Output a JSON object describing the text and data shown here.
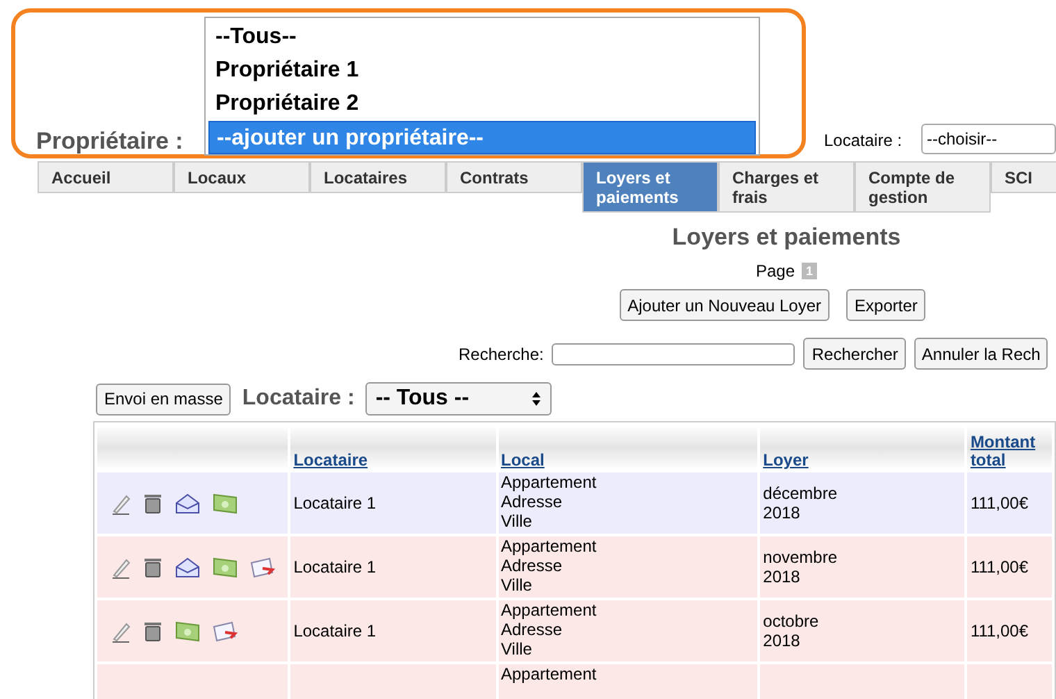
{
  "owner_picker": {
    "label": "Propriétaire :",
    "options": [
      {
        "label": "--Tous--",
        "selected": false
      },
      {
        "label": "Propriétaire 1",
        "selected": false
      },
      {
        "label": "Propriétaire 2",
        "selected": false
      },
      {
        "label": "--ajouter un propriétaire--",
        "selected": true
      }
    ]
  },
  "tenant_picker": {
    "label": "Locataire :",
    "value": "--choisir--"
  },
  "tabs": [
    {
      "label": "Accueil",
      "selected": false
    },
    {
      "label": "Locaux",
      "selected": false
    },
    {
      "label": "Locataires",
      "selected": false
    },
    {
      "label": "Contrats",
      "selected": false
    },
    {
      "label": "Loyers et paiements",
      "selected": true
    },
    {
      "label": "Charges et frais",
      "selected": false
    },
    {
      "label": "Compte de gestion",
      "selected": false
    },
    {
      "label": "SCI",
      "selected": false
    }
  ],
  "title": "Loyers et paiements",
  "pager": {
    "label": "Page",
    "pages": [
      "1"
    ]
  },
  "actions": [
    "Ajouter un Nouveau Loyer",
    "Exporter"
  ],
  "search": {
    "label": "Recherche:",
    "buttons": [
      "Rechercher",
      "Annuler la Rech"
    ]
  },
  "bulk_button": "Envoi en masse",
  "tenant_filter": {
    "label": "Locataire :",
    "value": "-- Tous --"
  },
  "table": {
    "columns": [
      "Locataire",
      "Local",
      "Loyer",
      "Montant total"
    ],
    "rows": [
      {
        "color": "#ececfc",
        "icons": [
          {
            "kind": "edit"
          },
          {
            "kind": "delete"
          },
          {
            "kind": "mail"
          },
          {
            "kind": "money"
          }
        ],
        "tenant": "Locataire 1",
        "local": [
          "Appartement",
          "Adresse",
          "Ville"
        ],
        "rent": [
          "décembre",
          "2018"
        ],
        "amount": "111,00€"
      },
      {
        "color": "#fde8e8",
        "icons": [
          {
            "kind": "edit"
          },
          {
            "kind": "delete"
          },
          {
            "kind": "mail"
          },
          {
            "kind": "money"
          },
          {
            "kind": "send"
          }
        ],
        "tenant": "Locataire 1",
        "local": [
          "Appartement",
          "Adresse",
          "Ville"
        ],
        "rent": [
          "novembre",
          "2018"
        ],
        "amount": "111,00€"
      },
      {
        "color": "#fde8e8",
        "icons": [
          {
            "kind": "edit"
          },
          {
            "kind": "delete"
          },
          {
            "kind": "money"
          },
          {
            "kind": "send"
          }
        ],
        "tenant": "Locataire 1",
        "local": [
          "Appartement",
          "Adresse",
          "Ville"
        ],
        "rent": [
          "octobre",
          "2018"
        ],
        "amount": "111,00€"
      },
      {
        "color": "#fde8e8",
        "local": [
          "Appartement"
        ],
        "rent": []
      }
    ]
  }
}
